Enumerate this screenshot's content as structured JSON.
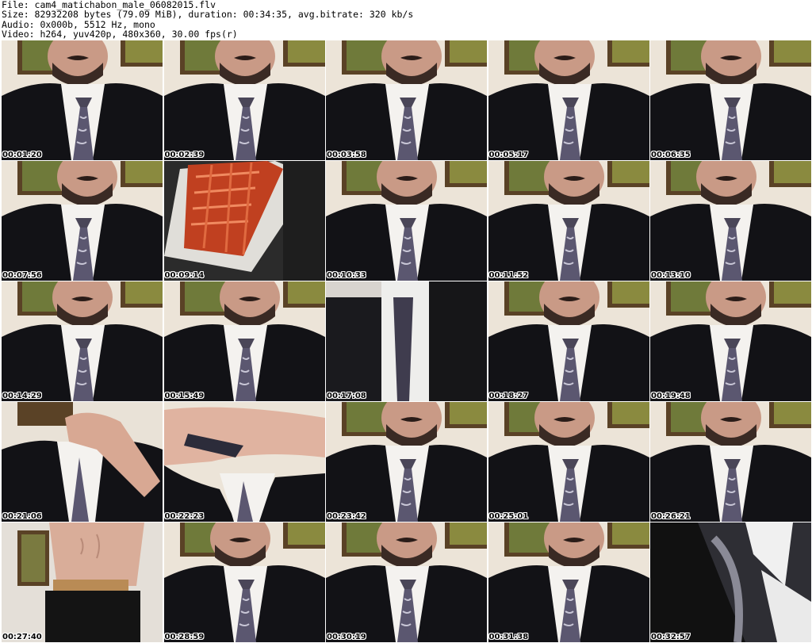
{
  "header": {
    "file_line": "File: cam4_matichabon_male_06082015.flv",
    "size_line": "Size: 82932208 bytes (79.09 MiB), duration: 00:34:35, avg.bitrate: 320 kb/s",
    "audio_line": "Audio: 0x000b, 5512 Hz, mono",
    "video_line": "Video: h264, yuv420p, 480x360, 30.00 fps(r)"
  },
  "thumbnails": [
    {
      "time": "00:01:20",
      "scene": "suit"
    },
    {
      "time": "00:02:39",
      "scene": "suit"
    },
    {
      "time": "00:03:58",
      "scene": "suit"
    },
    {
      "time": "00:05:17",
      "scene": "suit"
    },
    {
      "time": "00:06:35",
      "scene": "suit"
    },
    {
      "time": "00:07:56",
      "scene": "suit"
    },
    {
      "time": "00:09:14",
      "scene": "phone"
    },
    {
      "time": "00:10:33",
      "scene": "suit"
    },
    {
      "time": "00:11:52",
      "scene": "suit"
    },
    {
      "time": "00:13:10",
      "scene": "suit"
    },
    {
      "time": "00:14:29",
      "scene": "suit"
    },
    {
      "time": "00:15:49",
      "scene": "suit"
    },
    {
      "time": "00:17:08",
      "scene": "blur"
    },
    {
      "time": "00:18:27",
      "scene": "suit"
    },
    {
      "time": "00:19:48",
      "scene": "suit"
    },
    {
      "time": "00:21:06",
      "scene": "hand"
    },
    {
      "time": "00:22:23",
      "scene": "hands"
    },
    {
      "time": "00:23:42",
      "scene": "suit"
    },
    {
      "time": "00:25:01",
      "scene": "suit"
    },
    {
      "time": "00:26:21",
      "scene": "suit"
    },
    {
      "time": "00:27:40",
      "scene": "torso"
    },
    {
      "time": "00:28:59",
      "scene": "suit"
    },
    {
      "time": "00:30:19",
      "scene": "suit"
    },
    {
      "time": "00:31:38",
      "scene": "suit"
    },
    {
      "time": "00:32:57",
      "scene": "closeup"
    }
  ]
}
